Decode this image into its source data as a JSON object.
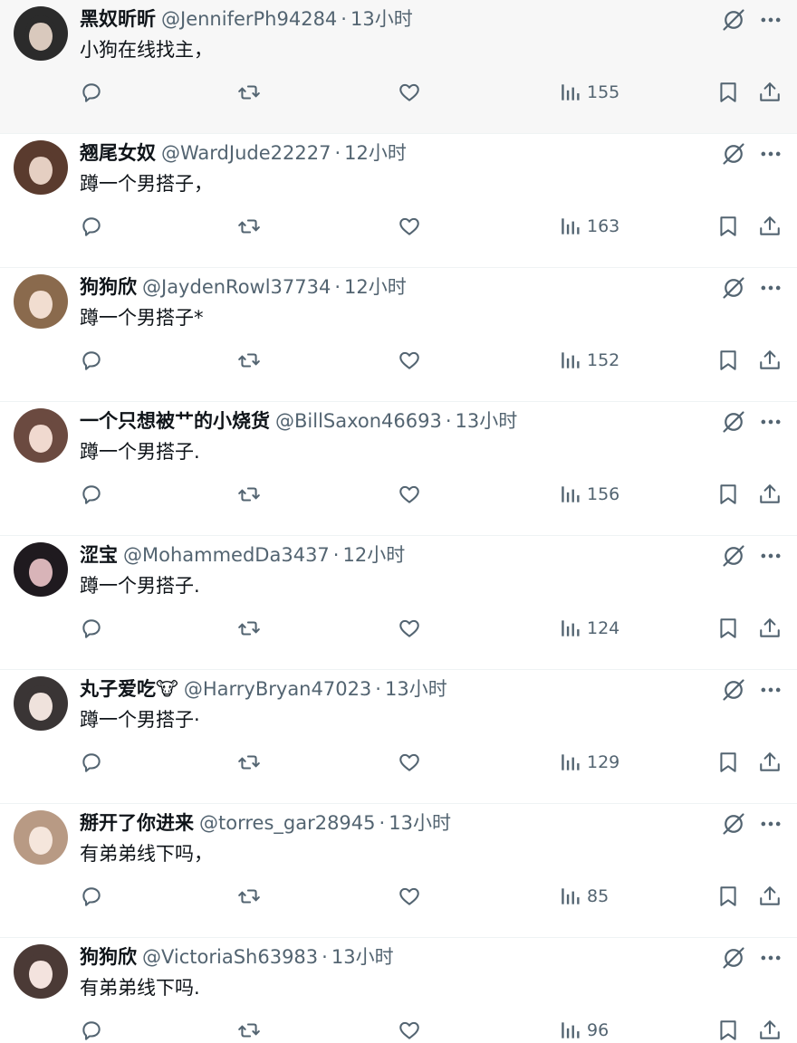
{
  "tweets": [
    {
      "name": "黑奴昕昕",
      "handle": "@JenniferPh94284",
      "separator": "·",
      "time": "13小时",
      "text": "小狗在线找主，",
      "views": "155",
      "avatar_colors": [
        "#2b2b2b",
        "#d9c9bd"
      ]
    },
    {
      "name": "翘尾女奴",
      "handle": "@WardJude22227",
      "separator": "·",
      "time": "12小时",
      "text": "蹲一个男搭子，",
      "views": "163",
      "avatar_colors": [
        "#5a3b2e",
        "#e5cfc2"
      ]
    },
    {
      "name": "狗狗欣",
      "handle": "@JaydenRowl37734",
      "separator": "·",
      "time": "12小时",
      "text": "蹲一个男搭子*",
      "views": "152",
      "avatar_colors": [
        "#8a6a4d",
        "#f1ddd0"
      ]
    },
    {
      "name": "一个只想被艹的小烧货",
      "handle": "@BillSaxon46693",
      "separator": "·",
      "time": "13小时",
      "text": "蹲一个男搭子.",
      "views": "156",
      "avatar_colors": [
        "#6b4a40",
        "#f0d9cf"
      ]
    },
    {
      "name": "涩宝",
      "handle": "@MohammedDa3437",
      "separator": "·",
      "time": "12小时",
      "text": "蹲一个男搭子.",
      "views": "124",
      "avatar_colors": [
        "#1f1a1f",
        "#d8b4b8"
      ]
    },
    {
      "name": "丸子爱吃🐮",
      "handle": "@HarryBryan47023",
      "separator": "·",
      "time": "13小时",
      "text": "蹲一个男搭子·",
      "views": "129",
      "avatar_colors": [
        "#3a3535",
        "#efe2dc"
      ]
    },
    {
      "name": "掰开了你进来",
      "handle": "@torres_gar28945",
      "separator": "·",
      "time": "13小时",
      "text": "有弟弟线下吗，",
      "views": "85",
      "avatar_colors": [
        "#b89a84",
        "#f5e6dc"
      ]
    },
    {
      "name": "狗狗欣",
      "handle": "@VictoriaSh63983",
      "separator": "·",
      "time": "13小时",
      "text": "有弟弟线下吗.",
      "views": "96",
      "avatar_colors": [
        "#4b3a36",
        "#f3e3de"
      ]
    }
  ],
  "icons": {
    "reply": "reply-icon",
    "retweet": "retweet-icon",
    "like": "like-icon",
    "views": "views-icon",
    "bookmark": "bookmark-icon",
    "share": "share-icon",
    "grok": "grok-icon",
    "more": "more-icon"
  },
  "colors": {
    "text": "#0f1419",
    "secondary": "#536471",
    "border": "#eff3f4",
    "hover": "#f7f7f7"
  }
}
